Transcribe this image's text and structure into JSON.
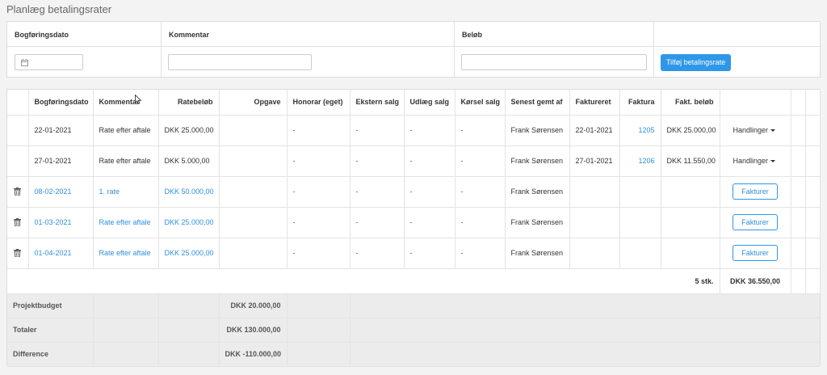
{
  "page": {
    "title": "Planlæg betalingsrater"
  },
  "form": {
    "headers": {
      "date": "Bogføringsdato",
      "comment": "Kommentar",
      "amount": "Beløb"
    },
    "date_value": "",
    "comment_value": "",
    "amount_value": "",
    "add_button": "Tilføj betalingsrate"
  },
  "table": {
    "headers": {
      "date": "Bogføringsdato",
      "comment": "Kommentar",
      "rate_amount": "Ratebeløb",
      "task": "Opgave",
      "fee": "Honorar (eget)",
      "ext_sales": "Ekstern salg",
      "outlay": "Udlæg salg",
      "driving": "Kørsel salg",
      "saved_by": "Senest gemt af",
      "invoiced": "Faktureret",
      "invoice": "Faktura",
      "invoice_amount": "Fakt. beløb"
    },
    "rows": [
      {
        "date": "22-01-2021",
        "comment": "Rate efter aftale",
        "rate_amount": "DKK 25.000,00",
        "task": "",
        "fee": "-",
        "ext_sales": "-",
        "outlay": "-",
        "driving": "-",
        "saved_by": "Frank Sørensen",
        "invoiced": "22-01-2021",
        "invoice": "1205",
        "invoice_amount": "DKK 25.000,00",
        "action": "Handlinger"
      },
      {
        "date": "27-01-2021",
        "comment": "Rate efter aftale",
        "rate_amount": "DKK 5.000,00",
        "task": "",
        "fee": "-",
        "ext_sales": "-",
        "outlay": "-",
        "driving": "-",
        "saved_by": "Frank Sørensen",
        "invoiced": "27-01-2021",
        "invoice": "1206",
        "invoice_amount": "DKK 11.550,00",
        "action": "Handlinger"
      },
      {
        "date": "08-02-2021",
        "comment": "1. rate",
        "rate_amount": "DKK 50.000,00",
        "task": "",
        "fee": "-",
        "ext_sales": "-",
        "outlay": "-",
        "driving": "-",
        "saved_by": "Frank Sørensen",
        "invoiced": "",
        "invoice": "",
        "invoice_amount": "",
        "action": "Fakturer"
      },
      {
        "date": "01-03-2021",
        "comment": "Rate efter aftale",
        "rate_amount": "DKK 25.000,00",
        "task": "",
        "fee": "-",
        "ext_sales": "-",
        "outlay": "-",
        "driving": "-",
        "saved_by": "Frank Sørensen",
        "invoiced": "",
        "invoice": "",
        "invoice_amount": "",
        "action": "Fakturer"
      },
      {
        "date": "01-04-2021",
        "comment": "Rate efter aftale",
        "rate_amount": "DKK 25.000,00",
        "task": "",
        "fee": "-",
        "ext_sales": "-",
        "outlay": "-",
        "driving": "-",
        "saved_by": "Frank Sørensen",
        "invoiced": "",
        "invoice": "",
        "invoice_amount": "",
        "action": "Fakturer"
      }
    ],
    "count_label": "5 stk.",
    "total_invoiced": "DKK 36.550,00",
    "summary": [
      {
        "label": "Projektbudget",
        "value": "DKK 20.000,00"
      },
      {
        "label": "Totaler",
        "value": "DKK 130.000,00"
      },
      {
        "label": "Difference",
        "value": "DKK -110.000,00"
      }
    ]
  },
  "colors": {
    "accent": "#2f97e8",
    "link": "#2f8fdc",
    "summary_bg": "#ececec"
  },
  "icons": {
    "date_input": "calendar-icon",
    "row_delete": "trash-icon",
    "dropdown": "caret-down-icon"
  }
}
